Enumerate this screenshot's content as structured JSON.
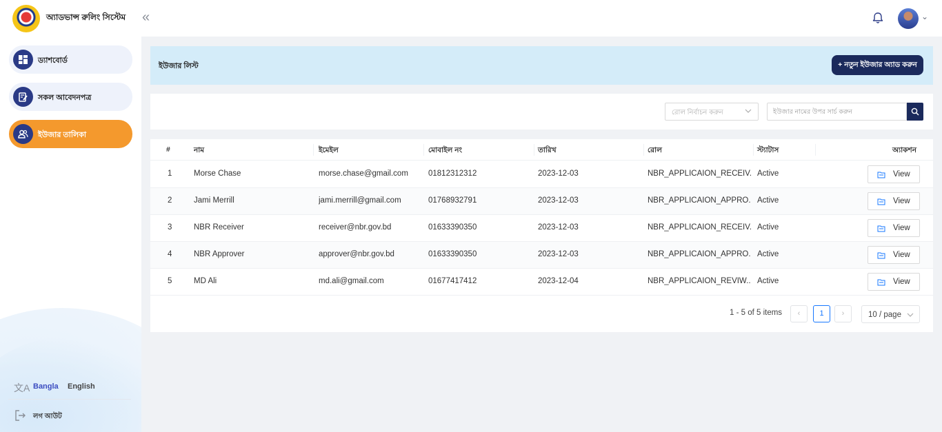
{
  "app": {
    "title": "অ্যাডভান্স রুলিং সিস্টেম"
  },
  "topbar": {
    "collapse_icon": "«",
    "notifications_icon": "bell-icon",
    "avatar_icon": "user-avatar",
    "chevron": "⌄"
  },
  "sidebar": {
    "items": [
      {
        "label": "ড্যাশবোর্ড",
        "icon": "dashboard-icon",
        "active": false
      },
      {
        "label": "সকল আবেদনপত্র",
        "icon": "document-edit-icon",
        "active": false
      },
      {
        "label": "ইউজার তালিকা",
        "icon": "users-icon",
        "active": true
      }
    ],
    "language": {
      "bangla": "Bangla",
      "english": "English",
      "active": "Bangla"
    },
    "logout_label": "লগ আউট"
  },
  "page": {
    "title": "ইউজার লিস্ট",
    "add_button": "+ নতুন ইউজার অ্যাড করুন"
  },
  "filters": {
    "role_placeholder": "রোল নির্বাচন করুন",
    "search_placeholder": "ইউজার নামের উপর সার্চ করুন"
  },
  "table": {
    "headers": {
      "index": "#",
      "name": "নাম",
      "email": "ইমেইল",
      "mobile": "মোবাইল নং",
      "date": "তারিখ",
      "role": "রোল",
      "status": "স্ট্যাটাস",
      "action": "অ্যাকশন"
    },
    "view_label": "View",
    "rows": [
      {
        "index": "1",
        "name": "Morse Chase",
        "email": "morse.chase@gmail.com",
        "mobile": "01812312312",
        "date": "2023-12-03",
        "role": "NBR_APPLICAION_RECEIV...",
        "status": "Active"
      },
      {
        "index": "2",
        "name": "Jami Merrill",
        "email": "jami.merrill@gmail.com",
        "mobile": "01768932791",
        "date": "2023-12-03",
        "role": "NBR_APPLICAION_APPRO...",
        "status": "Active"
      },
      {
        "index": "3",
        "name": "NBR Receiver",
        "email": "receiver@nbr.gov.bd",
        "mobile": "01633390350",
        "date": "2023-12-03",
        "role": "NBR_APPLICAION_RECEIV...",
        "status": "Active"
      },
      {
        "index": "4",
        "name": "NBR Approver",
        "email": "approver@nbr.gov.bd",
        "mobile": "01633390350",
        "date": "2023-12-03",
        "role": "NBR_APPLICAION_APPRO...",
        "status": "Active"
      },
      {
        "index": "5",
        "name": "MD Ali",
        "email": "md.ali@gmail.com",
        "mobile": "01677417412",
        "date": "2023-12-04",
        "role": "NBR_APPLICAION_REVIW...",
        "status": "Active"
      }
    ]
  },
  "pagination": {
    "summary": "1 - 5 of 5 items",
    "prev": "‹",
    "current_page": "1",
    "next": "›",
    "page_size": "10 / page"
  },
  "colors": {
    "primary": "#1b2a5c",
    "accent": "#f4992d",
    "banner": "#d4ecf9",
    "link": "#1677ff"
  }
}
